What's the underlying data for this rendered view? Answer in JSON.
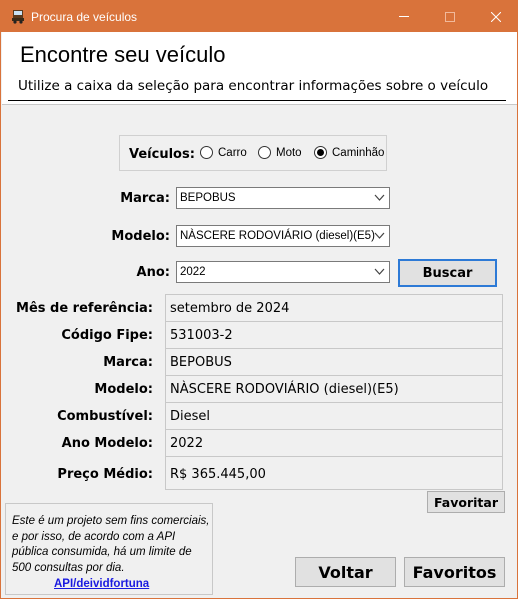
{
  "window": {
    "title": "Procura de veículos",
    "icon": "vehicle-app-icon",
    "titlebar_color": "#d9733b",
    "controls": {
      "minimize": "minimize-icon",
      "maximize": "maximize-icon",
      "close": "close-icon"
    }
  },
  "header": {
    "title": "Encontre seu veículo",
    "subtitle": "Utilize a caixa da seleção para encontrar informações sobre o veículo"
  },
  "vehicle_type": {
    "label": "Veículos:",
    "options": [
      {
        "label": "Carro",
        "checked": false
      },
      {
        "label": "Moto",
        "checked": false
      },
      {
        "label": "Caminhão",
        "checked": true
      }
    ]
  },
  "filters": {
    "marca": {
      "label": "Marca:",
      "value": "BEPOBUS"
    },
    "modelo": {
      "label": "Modelo:",
      "value": "NÀSCERE RODOVIÁRIO (diesel)(E5)"
    },
    "ano": {
      "label": "Ano:",
      "value": "2022"
    }
  },
  "buscar_button": "Buscar",
  "results": [
    {
      "label": "Mês de referência:",
      "value": "setembro de 2024"
    },
    {
      "label": "Código Fipe:",
      "value": "531003-2"
    },
    {
      "label": "Marca:",
      "value": "BEPOBUS"
    },
    {
      "label": "Modelo:",
      "value": "NÀSCERE RODOVIÁRIO (diesel)(E5)"
    },
    {
      "label": "Combustível:",
      "value": "Diesel"
    },
    {
      "label": "Ano Modelo:",
      "value": "2022"
    },
    {
      "label": "Preço Médio:",
      "value": "R$ 365.445,00"
    }
  ],
  "favoritar_button": "Favoritar",
  "note": {
    "text": "Este é um projeto sem fins comerciais, e por isso, de acordo com a API pública consumida, há um limite de 500 consultas por dia.",
    "link": "API/deividfortuna",
    "link_color": "#1a1ae0"
  },
  "footer_buttons": {
    "voltar": "Voltar",
    "favoritos": "Favoritos"
  }
}
